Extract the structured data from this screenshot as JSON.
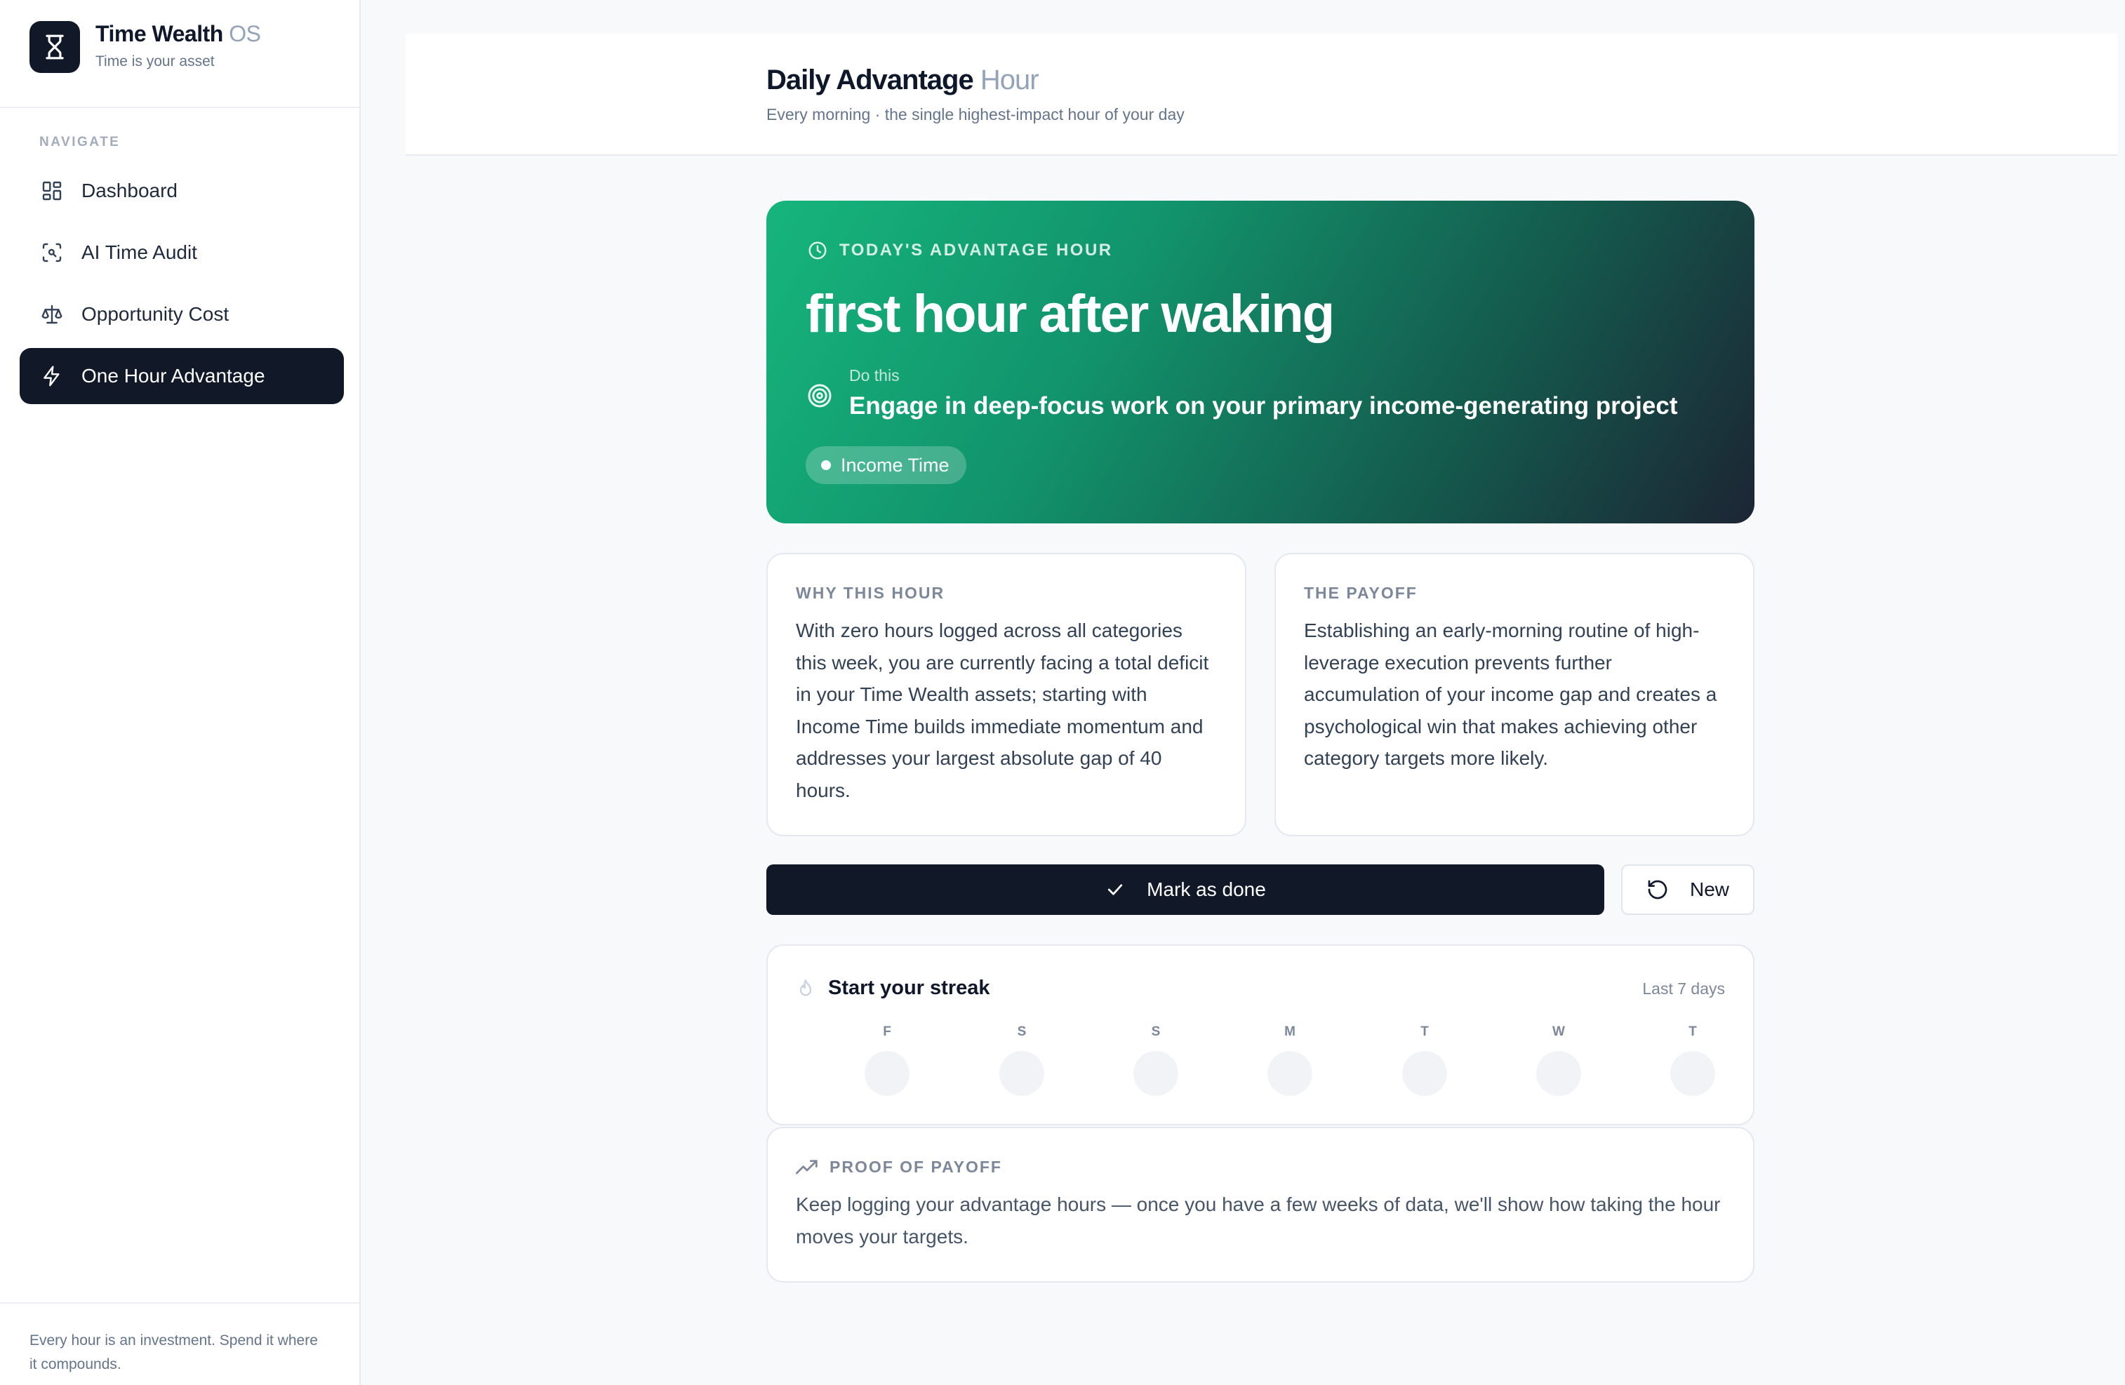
{
  "colors": {
    "primary": "#111827",
    "hero_gradient_start": "#16b57d",
    "hero_gradient_end": "#1c2534",
    "muted_text": "#64748b"
  },
  "brand": {
    "name": "Time Wealth",
    "suffix": "OS",
    "tagline": "Time is your asset",
    "icon": "hourglass-icon"
  },
  "sidebar": {
    "section_label": "NAVIGATE",
    "items": [
      {
        "label": "Dashboard",
        "icon": "grid-icon",
        "active": false
      },
      {
        "label": "AI Time Audit",
        "icon": "scan-icon",
        "active": false
      },
      {
        "label": "Opportunity Cost",
        "icon": "scale-icon",
        "active": false
      },
      {
        "label": "One Hour Advantage",
        "icon": "lightning-icon",
        "active": true
      }
    ],
    "footer": "Every hour is an investment. Spend it where it compounds."
  },
  "header": {
    "title": "Daily Advantage",
    "title_suffix": "Hour",
    "subtitle": "Every morning · the single highest-impact hour of your day"
  },
  "hero": {
    "kicker": "TODAY'S ADVANTAGE HOUR",
    "title": "first hour after waking",
    "do_label": "Do this",
    "do_text": "Engage in deep-focus work on your primary income-generating project",
    "category": "Income Time"
  },
  "why": {
    "kicker": "WHY THIS HOUR",
    "body": "With zero hours logged across all categories this week, you are currently facing a total deficit in your Time Wealth assets; starting with Income Time builds immediate momentum and addresses your largest absolute gap of 40 hours."
  },
  "payoff": {
    "kicker": "THE PAYOFF",
    "body": "Establishing an early-morning routine of high-leverage execution prevents further accumulation of your income gap and creates a psychological win that makes achieving other category targets more likely."
  },
  "actions": {
    "done_label": "Mark as done",
    "new_label": "New"
  },
  "streak": {
    "title": "Start your streak",
    "range": "Last 7 days",
    "days": [
      "F",
      "S",
      "S",
      "M",
      "T",
      "W",
      "T"
    ]
  },
  "proof": {
    "kicker": "PROOF OF PAYOFF",
    "body": "Keep logging your advantage hours — once you have a few weeks of data, we'll show how taking the hour moves your targets."
  }
}
